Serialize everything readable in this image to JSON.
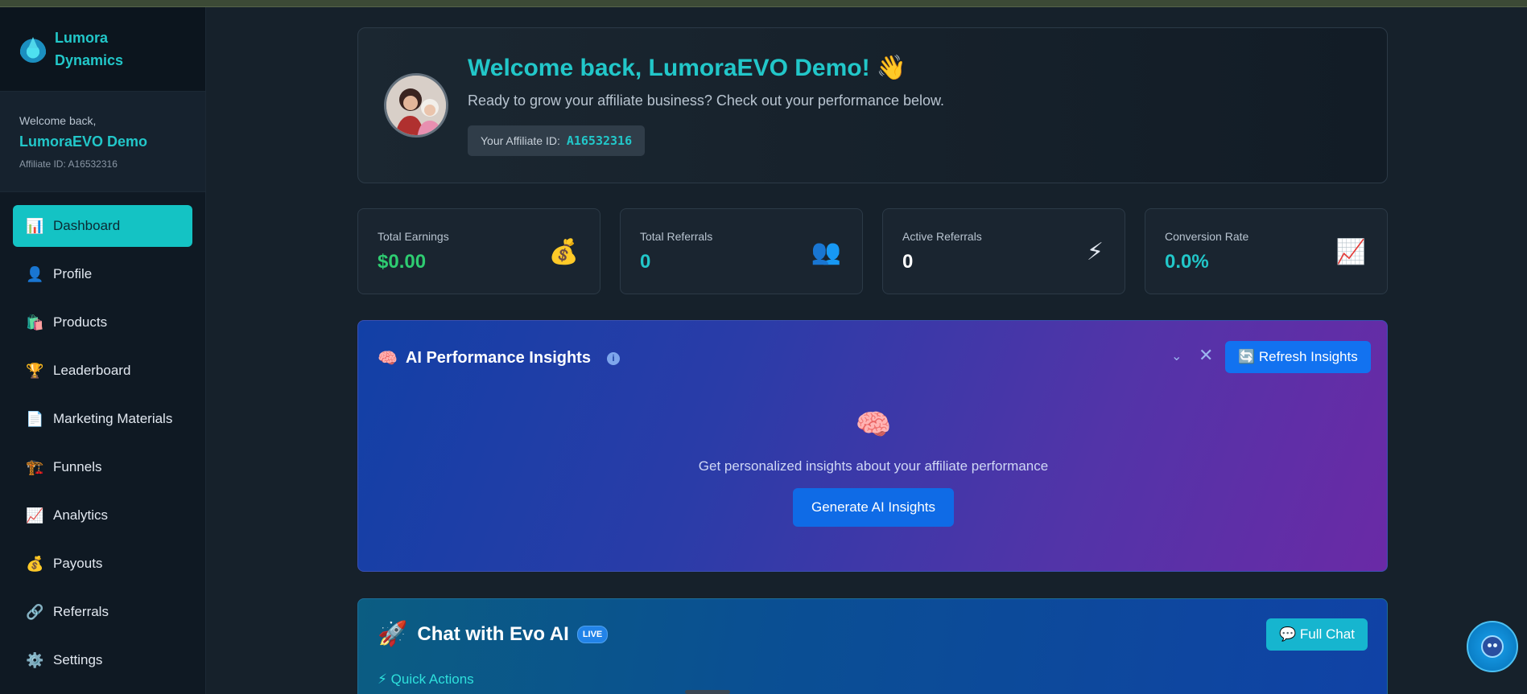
{
  "brand": {
    "name": "Lumora Dynamics"
  },
  "user": {
    "welcome_label": "Welcome back,",
    "name": "LumoraEVO Demo",
    "affiliate_line": "Affiliate ID: A16532316"
  },
  "nav": [
    {
      "icon": "📊",
      "label": "Dashboard",
      "active": true
    },
    {
      "icon": "👤",
      "label": "Profile"
    },
    {
      "icon": "🛍️",
      "label": "Products"
    },
    {
      "icon": "🏆",
      "label": "Leaderboard"
    },
    {
      "icon": "📄",
      "label": "Marketing Materials"
    },
    {
      "icon": "🏗️",
      "label": "Funnels"
    },
    {
      "icon": "📈",
      "label": "Analytics"
    },
    {
      "icon": "💰",
      "label": "Payouts"
    },
    {
      "icon": "🔗",
      "label": "Referrals"
    },
    {
      "icon": "⚙️",
      "label": "Settings"
    }
  ],
  "welcome": {
    "title": "Welcome back, LumoraEVO Demo! 👋",
    "subtitle": "Ready to grow your affiliate business? Check out your performance below.",
    "affiliate_label": "Your Affiliate ID:",
    "affiliate_value": "A16532316"
  },
  "stats": [
    {
      "label": "Total Earnings",
      "value": "$0.00",
      "icon": "💰",
      "color": "#2ecc71"
    },
    {
      "label": "Total Referrals",
      "value": "0",
      "icon": "👥",
      "color": "#22c7c9"
    },
    {
      "label": "Active Referrals",
      "value": "0",
      "icon": "⚡",
      "color": "#ffffff"
    },
    {
      "label": "Conversion Rate",
      "value": "0.0%",
      "icon": "📈",
      "color": "#22c7c9"
    }
  ],
  "insights": {
    "title_icon": "🧠",
    "title": "AI Performance Insights",
    "info_glyph": "i",
    "collapse_glyph": "⌄",
    "close_glyph": "✕",
    "refresh_label": "🔄 Refresh Insights",
    "center_icon": "🧠",
    "description": "Get personalized insights about your affiliate performance",
    "generate_label": "Generate AI Insights"
  },
  "chat": {
    "title_icon": "🚀",
    "title": "Chat with Evo AI",
    "badge": "LIVE",
    "full_chat_label": "💬 Full Chat",
    "quick_actions": "⚡ Quick Actions"
  },
  "icons": {
    "brand": "logo-icon",
    "bot": "robot-icon"
  }
}
